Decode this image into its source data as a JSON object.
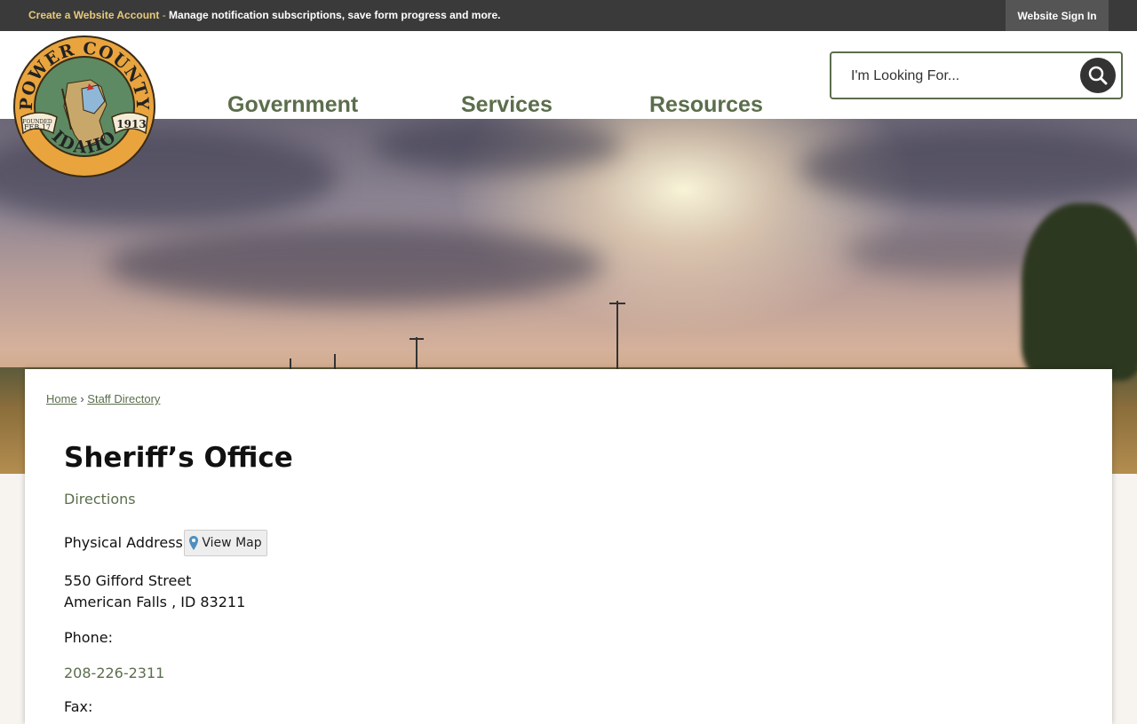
{
  "topbar": {
    "create_account_label": "Create a Website Account",
    "separator": " - ",
    "description": "Manage notification subscriptions, save form progress and more.",
    "signin_label": "Website Sign In"
  },
  "logo": {
    "top_text": "POWER COUNTY",
    "bottom_text": "IDAHO",
    "founded_label": "FOUNDED",
    "founded_date": "FEB 17",
    "year": "1913"
  },
  "nav": {
    "items": [
      {
        "label": "Government"
      },
      {
        "label": "Services"
      },
      {
        "label": "Resources"
      }
    ]
  },
  "search": {
    "placeholder": "I'm Looking For...",
    "icon": "search-icon"
  },
  "breadcrumb": {
    "home": "Home",
    "separator": "›",
    "current": "Staff Directory"
  },
  "main": {
    "title": "Sheriff’s Office",
    "directions_link": "Directions",
    "physical_address_label": "Physical Address:",
    "view_map_label": "View Map",
    "address_line1": "550 Gifford Street",
    "address_line2": "American Falls , ID 83211",
    "phone_label": "Phone:",
    "phone_value": "208-226-2311",
    "fax_label": "Fax:"
  },
  "colors": {
    "brand_green": "#5b6e4c",
    "topbar_bg": "#3a3a3a",
    "accent_gold": "#e8c97a"
  }
}
